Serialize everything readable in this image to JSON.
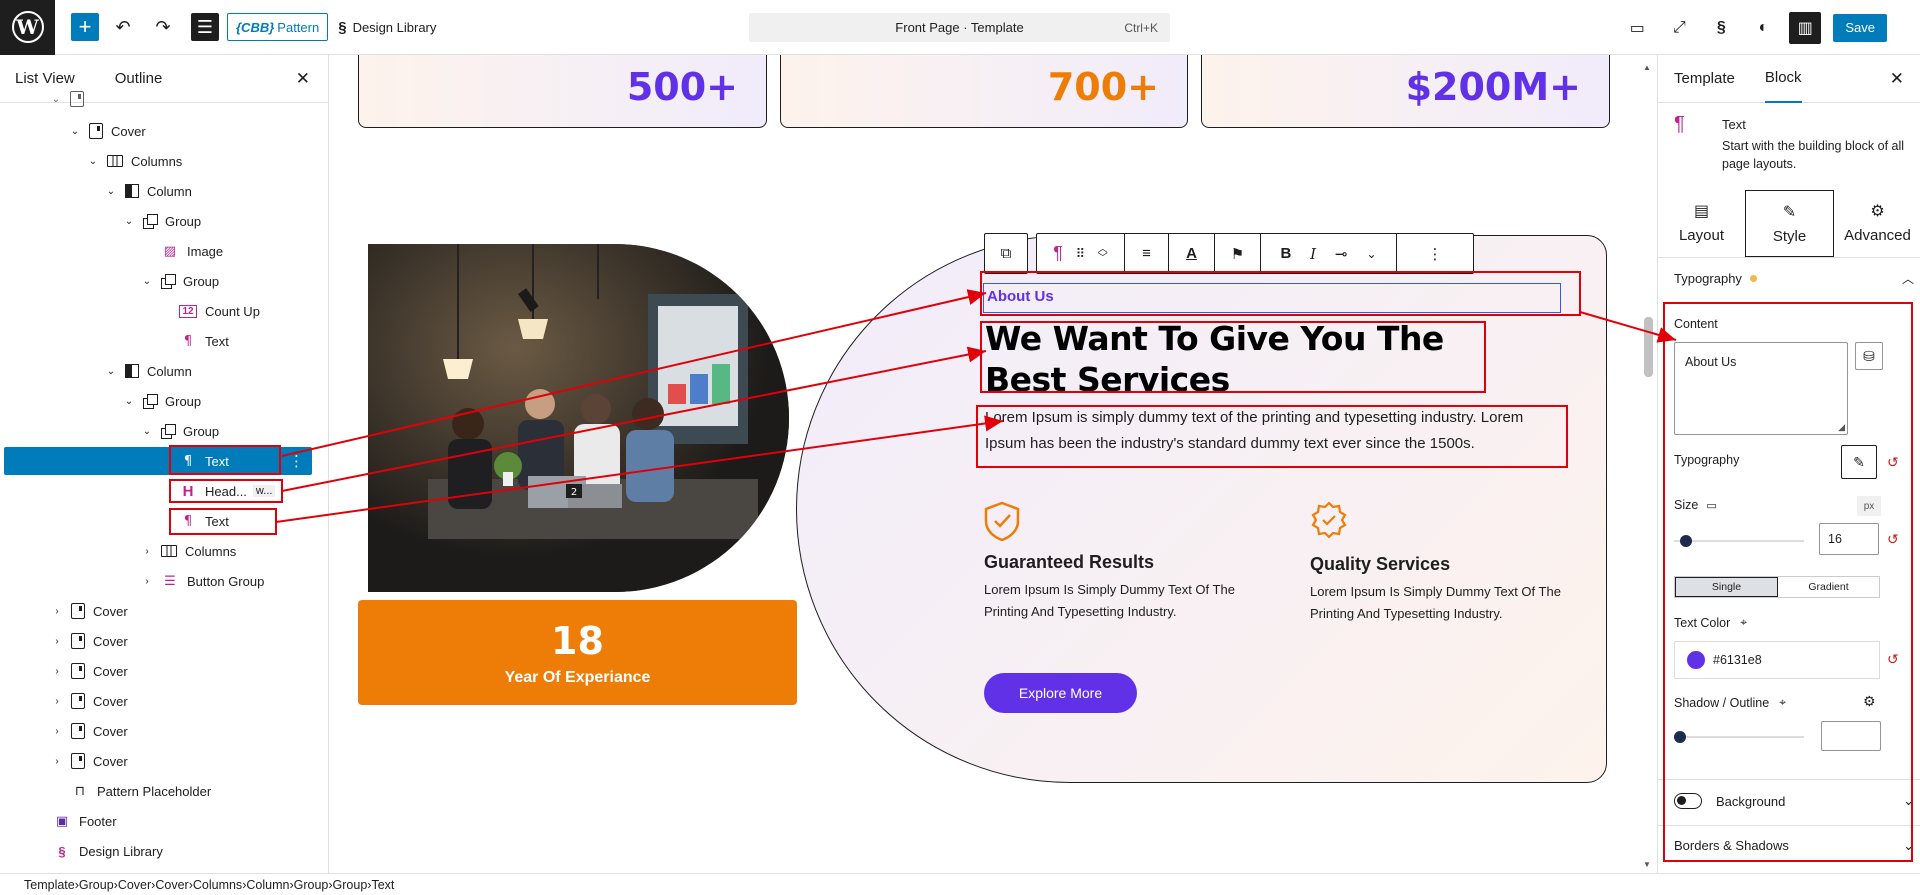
{
  "topbar": {
    "wp_logo": "W",
    "pattern_badge_prefix": "{CBB}",
    "pattern_badge_label": "Pattern",
    "design_library_label": "Design Library",
    "command_title": "Front Page · Template",
    "command_shortcut": "Ctrl+K",
    "save_label": "Save"
  },
  "left_panel": {
    "tabs": [
      "List View",
      "Outline"
    ],
    "rows": [
      {
        "label": "Cover",
        "depth": 3,
        "chev": "v",
        "icon": "box"
      },
      {
        "label": "Columns",
        "depth": 4,
        "chev": "v",
        "icon": "cols"
      },
      {
        "label": "Column",
        "depth": 5,
        "chev": "v",
        "icon": "col"
      },
      {
        "label": "Group",
        "depth": 6,
        "chev": "v",
        "icon": "group"
      },
      {
        "label": "Image",
        "depth": 7,
        "chev": "",
        "icon": "image"
      },
      {
        "label": "Group",
        "depth": 7,
        "chev": "v",
        "icon": "group"
      },
      {
        "label": "Count Up",
        "depth": 8,
        "chev": "",
        "icon": "countup"
      },
      {
        "label": "Text",
        "depth": 8,
        "chev": "",
        "icon": "para"
      },
      {
        "label": "Column",
        "depth": 5,
        "chev": "v",
        "icon": "col"
      },
      {
        "label": "Group",
        "depth": 6,
        "chev": "v",
        "icon": "group"
      },
      {
        "label": "Group",
        "depth": 7,
        "chev": "v",
        "icon": "group"
      },
      {
        "label": "Text",
        "depth": 8,
        "chev": "",
        "icon": "para",
        "selected": true
      },
      {
        "label": "Head...",
        "depth": 8,
        "chev": "",
        "icon": "heading",
        "suffix": "w..."
      },
      {
        "label": "Text",
        "depth": 8,
        "chev": "",
        "icon": "para"
      },
      {
        "label": "Columns",
        "depth": 7,
        "chev": ">",
        "icon": "cols"
      },
      {
        "label": "Button Group",
        "depth": 7,
        "chev": ">",
        "icon": "btngroup"
      },
      {
        "label": "Cover",
        "depth": 2,
        "chev": ">",
        "icon": "box"
      },
      {
        "label": "Cover",
        "depth": 2,
        "chev": ">",
        "icon": "box"
      },
      {
        "label": "Cover",
        "depth": 2,
        "chev": ">",
        "icon": "box"
      },
      {
        "label": "Cover",
        "depth": 2,
        "chev": ">",
        "icon": "box"
      },
      {
        "label": "Cover",
        "depth": 2,
        "chev": ">",
        "icon": "box"
      },
      {
        "label": "Cover",
        "depth": 2,
        "chev": ">",
        "icon": "box"
      },
      {
        "label": "Pattern Placeholder",
        "depth": 2,
        "chev": "",
        "icon": "placeholder"
      },
      {
        "label": "Footer",
        "depth": 1,
        "chev": "",
        "icon": "footer"
      },
      {
        "label": "Design Library",
        "depth": 1,
        "chev": "",
        "icon": "stackable"
      }
    ]
  },
  "canvas": {
    "stats": [
      "500+",
      "700+",
      "$200M+"
    ],
    "stat_colors": [
      "#6131e8",
      "#ee7d08",
      "#6131e8"
    ],
    "experience_number": "18",
    "experience_label": "Year Of Experiance",
    "about_label": "About Us",
    "heading": "We Want To Give You The Best Services",
    "paragraph": "Lorem Ipsum is simply dummy text of the printing and typesetting industry. Lorem Ipsum has been the industry's standard dummy text ever since the 1500s.",
    "features": [
      {
        "title": "Guaranteed Results",
        "text": "Lorem Ipsum Is Simply Dummy Text Of The Printing And Typesetting Industry."
      },
      {
        "title": "Quality Services",
        "text": "Lorem Ipsum Is Simply Dummy Text Of The Printing And Typesetting Industry."
      }
    ],
    "explore_label": "Explore More",
    "photo_badge": "2"
  },
  "right_panel": {
    "tabs": [
      "Template",
      "Block"
    ],
    "block_name": "Text",
    "block_desc": "Start with the building block of all page layouts.",
    "subtabs": [
      "Layout",
      "Style",
      "Advanced"
    ],
    "typography_section": "Typography",
    "content_label": "Content",
    "content_value": "About Us",
    "typography_label": "Typography",
    "size_label": "Size",
    "size_unit": "px",
    "size_value": "16",
    "size_fraction": 0.05,
    "fill_modes": [
      "Single",
      "Gradient"
    ],
    "text_color_label": "Text Color",
    "text_color_value": "#6131e8",
    "shadow_label": "Shadow / Outline",
    "shadow_fraction": 0.0,
    "background_label": "Background",
    "borders_label": "Borders & Shadows"
  },
  "breadcrumbs": [
    "Template",
    "Group",
    "Cover",
    "Cover",
    "Columns",
    "Column",
    "Group",
    "Group",
    "Text"
  ]
}
